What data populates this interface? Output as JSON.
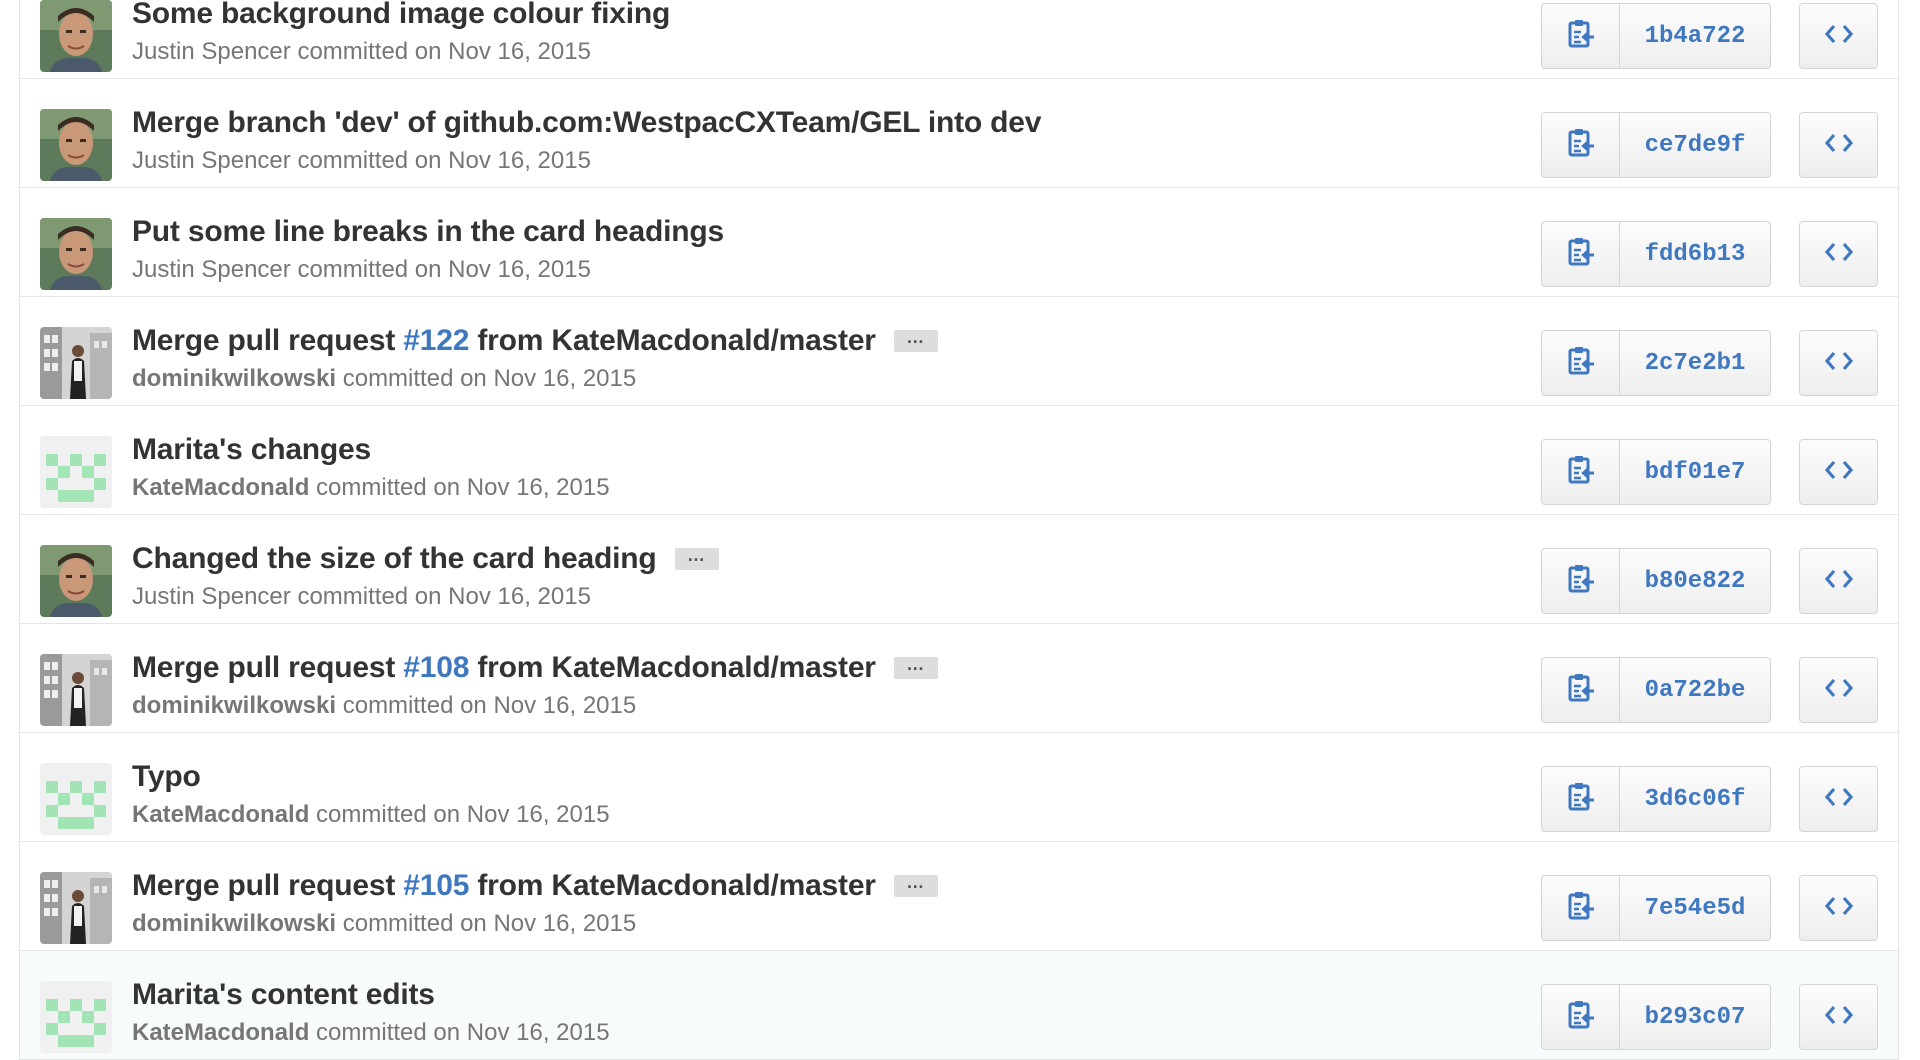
{
  "commits": [
    {
      "title_pre": "Some background image colour fixing",
      "pr": "",
      "title_post": "",
      "author": "Justin Spencer",
      "author_bold": false,
      "committed_text": "committed on Nov 16, 2015",
      "sha": "1b4a722",
      "avatar": "photo-man",
      "ellipsis": false,
      "highlighted": false
    },
    {
      "title_pre": "Merge branch 'dev' of github.com:WestpacCXTeam/GEL into dev",
      "pr": "",
      "title_post": "",
      "author": "Justin Spencer",
      "author_bold": false,
      "committed_text": "committed on Nov 16, 2015",
      "sha": "ce7de9f",
      "avatar": "photo-man",
      "ellipsis": false,
      "highlighted": false
    },
    {
      "title_pre": "Put some line breaks in the card headings",
      "pr": "",
      "title_post": "",
      "author": "Justin Spencer",
      "author_bold": false,
      "committed_text": "committed on Nov 16, 2015",
      "sha": "fdd6b13",
      "avatar": "photo-man",
      "ellipsis": false,
      "highlighted": false
    },
    {
      "title_pre": "Merge pull request ",
      "pr": "#122",
      "title_post": " from KateMacdonald/master",
      "author": "dominikwilkowski",
      "author_bold": true,
      "committed_text": "committed on Nov 16, 2015",
      "sha": "2c7e2b1",
      "avatar": "photo-street",
      "ellipsis": true,
      "highlighted": false
    },
    {
      "title_pre": "Marita's changes",
      "pr": "",
      "title_post": "",
      "author": "KateMacdonald",
      "author_bold": true,
      "committed_text": "committed on Nov 16, 2015",
      "sha": "bdf01e7",
      "avatar": "identicon-green",
      "ellipsis": false,
      "highlighted": false
    },
    {
      "title_pre": "Changed the size of the card heading",
      "pr": "",
      "title_post": "",
      "author": "Justin Spencer",
      "author_bold": false,
      "committed_text": "committed on Nov 16, 2015",
      "sha": "b80e822",
      "avatar": "photo-man",
      "ellipsis": true,
      "highlighted": false
    },
    {
      "title_pre": "Merge pull request ",
      "pr": "#108",
      "title_post": " from KateMacdonald/master",
      "author": "dominikwilkowski",
      "author_bold": true,
      "committed_text": "committed on Nov 16, 2015",
      "sha": "0a722be",
      "avatar": "photo-street",
      "ellipsis": true,
      "highlighted": false
    },
    {
      "title_pre": "Typo",
      "pr": "",
      "title_post": "",
      "author": "KateMacdonald",
      "author_bold": true,
      "committed_text": "committed on Nov 16, 2015",
      "sha": "3d6c06f",
      "avatar": "identicon-green",
      "ellipsis": false,
      "highlighted": false
    },
    {
      "title_pre": "Merge pull request ",
      "pr": "#105",
      "title_post": " from KateMacdonald/master",
      "author": "dominikwilkowski",
      "author_bold": true,
      "committed_text": "committed on Nov 16, 2015",
      "sha": "7e54e5d",
      "avatar": "photo-street",
      "ellipsis": true,
      "highlighted": false
    },
    {
      "title_pre": "Marita's content edits",
      "pr": "",
      "title_post": "",
      "author": "KateMacdonald",
      "author_bold": true,
      "committed_text": "committed on Nov 16, 2015",
      "sha": "b293c07",
      "avatar": "identicon-green",
      "ellipsis": false,
      "highlighted": true
    }
  ],
  "ui": {
    "ellipsis_label": "…",
    "copy_icon": "clipboard-icon",
    "browse_icon": "code-icon"
  },
  "colors": {
    "link": "#4078c0",
    "identicon": "#a3e4b6",
    "row_highlight": "#f7fbfc"
  }
}
